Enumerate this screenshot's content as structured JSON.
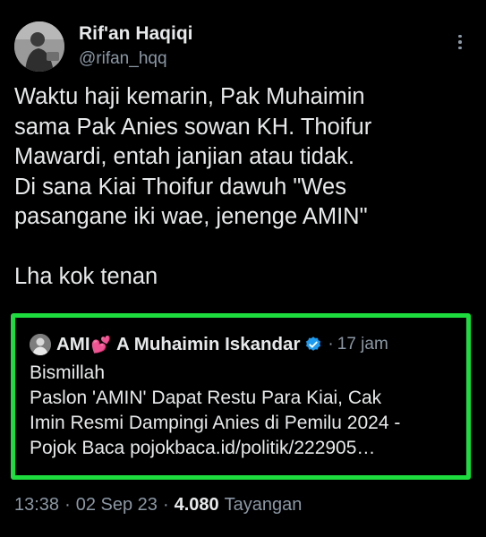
{
  "author": {
    "display_name": "Rif'an Haqiqi",
    "handle": "@rifan_hqq"
  },
  "tweet": {
    "text": "Waktu haji kemarin, Pak Muhaimin\nsama Pak Anies sowan KH. Thoifur\nMawardi, entah janjian atau tidak.\nDi sana Kiai Thoifur dawuh \"Wes\npasangane iki wae, jenenge AMIN\"\n\nLha kok tenan"
  },
  "quoted_tweet": {
    "name_part1": "AMI",
    "name_emoji": "💕",
    "name_part2": "A Muhaimin Iskandar",
    "separator": "·",
    "time": "17 jam",
    "text": "Bismillah\nPaslon 'AMIN' Dapat Restu Para Kiai, Cak\nImin Resmi Dampingi Anies di Pemilu 2024 -\nPojok Baca pojokbaca.id/politik/222905…"
  },
  "meta": {
    "time": "13:38",
    "dot1": "·",
    "date": "02 Sep 23",
    "dot2": "·",
    "views_count": "4.080",
    "views_label": "Tayangan"
  },
  "colors": {
    "background": "#000000",
    "text_primary": "#e7e9ea",
    "text_secondary": "#8b98a5",
    "highlight_border": "#1ddc3e",
    "verified_badge": "#1d9bf0"
  },
  "icons": {
    "more": "more-vertical-icon",
    "verified": "verified-badge-icon"
  }
}
